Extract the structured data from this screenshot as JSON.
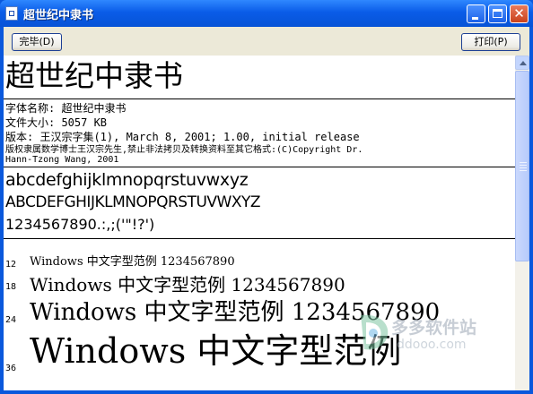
{
  "window": {
    "title": "超世纪中隶书",
    "icon": "font-file-icon",
    "controls": [
      "minimize-icon",
      "maximize-icon",
      "close-icon"
    ],
    "title_bar_color": "#0a58dc"
  },
  "toolbar": {
    "done_label": "完毕(D)",
    "print_label": "打印(P)"
  },
  "preview": {
    "font_title": "超世纪中隶书",
    "info": {
      "name_line": "字体名称: 超世纪中隶书",
      "size_line": "文件大小: 5057 KB",
      "version_line": "版本: 王汉宗字集(1), March 8, 2001; 1.00, initial release",
      "copyright_line1": "版权隶属数学博士王汉宗先生,禁止非法拷贝及转换资料至其它格式:(C)Copyright Dr.",
      "copyright_line2": "Hann-Tzong Wang, 2001"
    },
    "charset": {
      "lowercase": "abcdefghijklmnopqrstuvwxyz",
      "uppercase": "ABCDEFGHIJKLMNOPQRSTUVWXYZ",
      "digits_symbols": "1234567890.:,;('\"!?')"
    },
    "samples": [
      {
        "size": "12",
        "text": "Windows  中文字型范例  1234567890"
      },
      {
        "size": "18",
        "text": "Windows  中文字型范例  1234567890"
      },
      {
        "size": "24",
        "text": "Windows  中文字型范例  1234567890"
      },
      {
        "size": "36",
        "text": "Windows  中文字型范例"
      }
    ]
  },
  "watermark": {
    "text": "多多软件站",
    "url": "ddooo.com",
    "icon": "ddooo-logo-icon"
  }
}
